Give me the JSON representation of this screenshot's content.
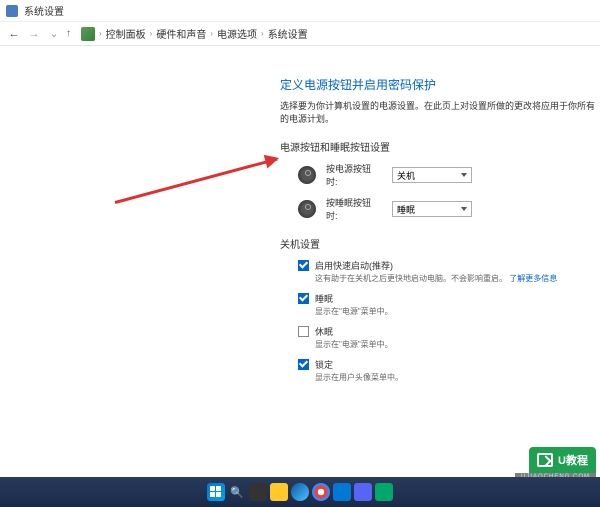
{
  "window": {
    "title": "系统设置"
  },
  "nav": {
    "breadcrumb": {
      "root": "控制面板",
      "level1": "硬件和声音",
      "level2": "电源选项",
      "level3": "系统设置"
    }
  },
  "page": {
    "heading": "定义电源按钮并启用密码保护",
    "subtext": "选择要为你计算机设置的电源设置。在此页上对设置所做的更改将应用于你所有的电源计划。",
    "section1_label": "电源按钮和睡眠按钮设置",
    "power_button": {
      "label": "按电源按钮时:",
      "value": "关机"
    },
    "sleep_button": {
      "label": "按睡眠按钮时:",
      "value": "睡眠"
    },
    "section2_label": "关机设置",
    "fast_startup": {
      "label": "启用快速启动(推荐)",
      "desc_a": "这有助于在关机之后更快地启动电脑。不会影响重启。",
      "link": "了解更多信息"
    },
    "sleep": {
      "label": "睡眠",
      "desc": "显示在\"电源\"菜单中。"
    },
    "hibernate": {
      "label": "休眠",
      "desc": "显示在\"电源\"菜单中。"
    },
    "lock": {
      "label": "锁定",
      "desc": "显示在用户头像菜单中。"
    }
  },
  "watermark": {
    "brand": "U教程",
    "url": "UJIAOCHENG.COM"
  }
}
